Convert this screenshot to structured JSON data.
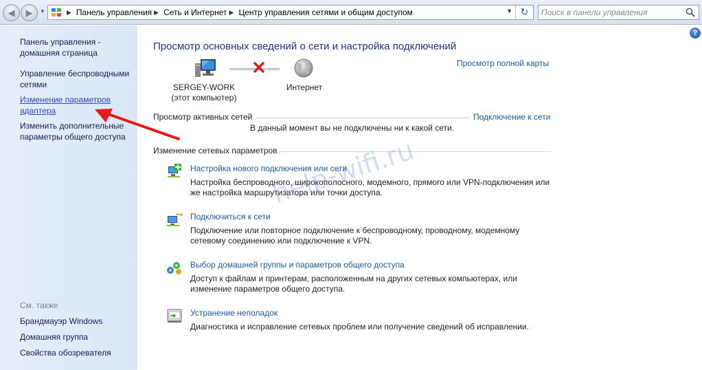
{
  "address_bar": {
    "breadcrumbs": [
      "Панель управления",
      "Сеть и Интернет",
      "Центр управления сетями и общим доступом"
    ],
    "search_placeholder": "Поиск в панели управления"
  },
  "sidebar": {
    "links": [
      {
        "label": "Панель управления - домашняя страница",
        "active": false
      },
      {
        "label": "Управление беспроводными сетями",
        "active": false
      },
      {
        "label": "Изменение параметров адаптера",
        "active": true
      },
      {
        "label": "Изменить дополнительные параметры общего доступа",
        "active": false
      }
    ],
    "see_also_title": "См. также",
    "see_also": [
      "Брандмауэр Windows",
      "Домашняя группа",
      "Свойства обозревателя"
    ]
  },
  "main": {
    "title": "Просмотр основных сведений о сети и настройка подключений",
    "full_map_link": "Просмотр полной карты",
    "computer": {
      "name": "SERGEY-WORK",
      "subtitle": "(этот компьютер)"
    },
    "internet_label": "Интернет",
    "active_networks": {
      "heading": "Просмотр активных сетей",
      "connect_link": "Подключение к сети",
      "status": "В данный момент вы не подключены ни к какой сети."
    },
    "change_settings": {
      "heading": "Изменение сетевых параметров",
      "tasks": [
        {
          "icon": "new-connection-icon",
          "title": "Настройка нового подключения или сети",
          "desc": "Настройка беспроводного, широкополосного, модемного, прямого или VPN-подключения или же настройка маршрутизатора или точки доступа."
        },
        {
          "icon": "connect-network-icon",
          "title": "Подключиться к сети",
          "desc": "Подключение или повторное подключение к беспроводному, проводному, модемному сетевому соединению или подключение к VPN."
        },
        {
          "icon": "homegroup-icon",
          "title": "Выбор домашней группы и параметров общего доступа",
          "desc": "Доступ к файлам и принтерам, расположенным на других сетевых компьютерах, или изменение параметров общего доступа."
        },
        {
          "icon": "troubleshoot-icon",
          "title": "Устранение неполадок",
          "desc": "Диагностика и исправление сетевых проблем или получение сведений об исправлении."
        }
      ]
    }
  },
  "watermark": "help-wifi.ru"
}
